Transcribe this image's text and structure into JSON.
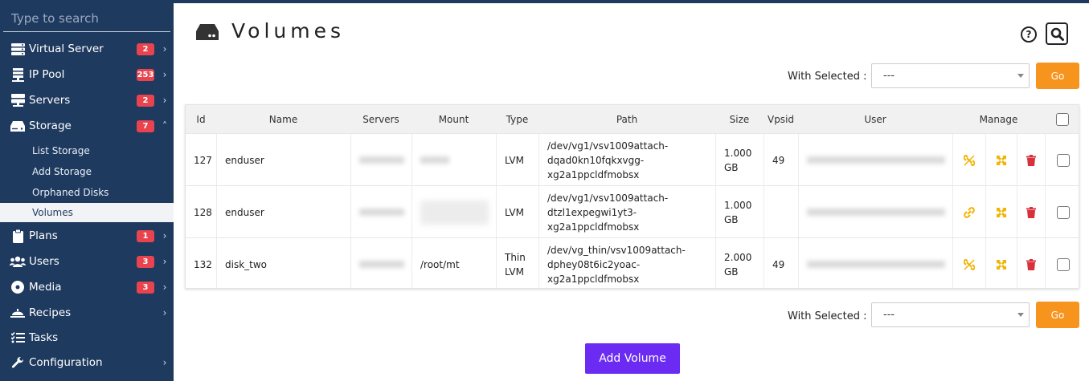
{
  "search": {
    "placeholder": "Type to search"
  },
  "sidebar": {
    "items": [
      {
        "label": "Virtual Server",
        "badge": "2",
        "icon": "server-rack-icon",
        "chevron": "›"
      },
      {
        "label": "IP Pool",
        "badge": "253",
        "icon": "ip-pool-icon",
        "chevron": "›"
      },
      {
        "label": "Servers",
        "badge": "2",
        "icon": "servers-monitor-icon",
        "chevron": "›"
      },
      {
        "label": "Storage",
        "badge": "7",
        "icon": "hard-drive-icon",
        "chevron": "˄"
      },
      {
        "label": "Plans",
        "badge": "1",
        "icon": "clipboard-icon",
        "chevron": "›"
      },
      {
        "label": "Users",
        "badge": "3",
        "icon": "users-icon",
        "chevron": "›"
      },
      {
        "label": "Media",
        "badge": "3",
        "icon": "disc-icon",
        "chevron": "›"
      },
      {
        "label": "Recipes",
        "badge": "",
        "icon": "chef-hat-icon",
        "chevron": "›"
      },
      {
        "label": "Tasks",
        "badge": "",
        "icon": "tasks-list-icon",
        "chevron": ""
      },
      {
        "label": "Configuration",
        "badge": "",
        "icon": "wrench-icon",
        "chevron": "›"
      }
    ],
    "storage_sub": [
      "List Storage",
      "Add Storage",
      "Orphaned Disks",
      "Volumes"
    ]
  },
  "page": {
    "title": "Volumes"
  },
  "with_selected": {
    "label": "With Selected :",
    "value": "---",
    "go": "Go"
  },
  "table": {
    "headers": {
      "id": "Id",
      "name": "Name",
      "servers": "Servers",
      "mount": "Mount",
      "type": "Type",
      "path": "Path",
      "size": "Size",
      "vpsid": "Vpsid",
      "user": "User",
      "manage": "Manage"
    },
    "rows": [
      {
        "id": "127",
        "name": "enduser",
        "mount": "",
        "type": "LVM",
        "path": [
          "/dev/vg1/vsv1009attach-",
          "dqad0kn10fqkxvgg-",
          "xg2a1ppcldfmobsx"
        ],
        "size": [
          "1.000",
          "GB"
        ],
        "vpsid": "49",
        "link_icon": "unlink-icon"
      },
      {
        "id": "128",
        "name": "enduser",
        "mount": "",
        "type": "LVM",
        "path": [
          "/dev/vg1/vsv1009attach-",
          "dtzl1expegwi1yt3-",
          "xg2a1ppcldfmobsx"
        ],
        "size": [
          "1.000",
          "GB"
        ],
        "vpsid": "",
        "link_icon": "link-icon"
      },
      {
        "id": "132",
        "name": "disk_two",
        "mount": "/root/mt",
        "type": "Thin LVM",
        "path": [
          "/dev/vg_thin/vsv1009attach-",
          "dphey08t6ic2yoac-",
          "xg2a1ppcldfmobsx"
        ],
        "size": [
          "2.000",
          "GB"
        ],
        "vpsid": "49",
        "link_icon": "unlink-icon"
      }
    ]
  },
  "actions": {
    "add_volume": "Add Volume"
  },
  "colors": {
    "sidebar": "#1f3a5f",
    "badge": "#e8434e",
    "go": "#f7941d",
    "add": "#6c2bf2",
    "icon_yellow": "#f0b400",
    "delete_red": "#d9313c"
  }
}
